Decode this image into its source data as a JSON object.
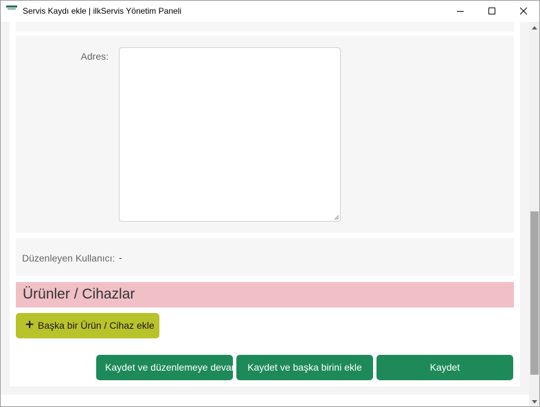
{
  "window": {
    "title": "Servis Kaydı ekle | ilkServis Yönetim Paneli",
    "icons": {
      "app": "app-logo-icon",
      "minimize": "minimize-icon",
      "maximize": "maximize-icon",
      "close": "close-icon"
    }
  },
  "form": {
    "address": {
      "label": "Adres:",
      "value": ""
    },
    "editor_user": {
      "label": "Düzenleyen Kullanıcı:",
      "value": "-"
    }
  },
  "products_section": {
    "title": "Ürünler / Cihazlar",
    "add_button": {
      "icon": "plus-icon",
      "label": "Başka bir Ürün / Cihaz ekle"
    }
  },
  "actions": {
    "save_and_continue": "Kaydet ve düzenlemeye devam et",
    "save_and_add_another": "Kaydet ve başka birini ekle",
    "save": "Kaydet"
  },
  "colors": {
    "primary_green": "#1e8a5a",
    "add_button_olive": "#b8c22a",
    "section_header_pink": "#f0c0c6",
    "footer_dark": "#1f2226"
  }
}
